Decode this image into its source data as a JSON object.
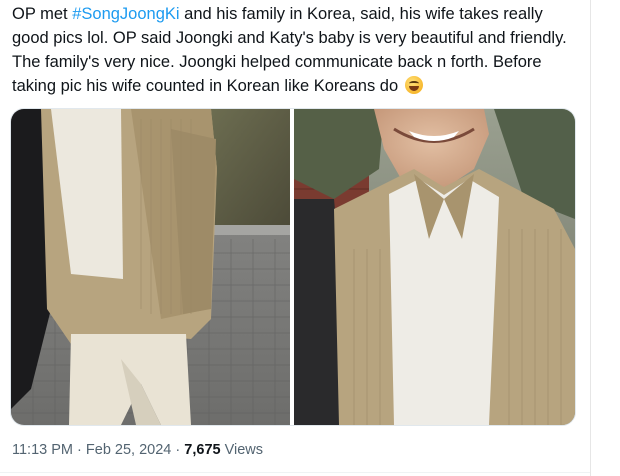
{
  "tweet": {
    "text_before": "OP met ",
    "hashtag": "#SongJoongKi",
    "text_after": " and his family in Korea, said, his wife takes really good pics lol. OP said Joongki and Katy's baby is very beautiful and friendly. The family's very nice. Joongki helped communicate back n forth. Before taking pic his wife counted in Korean like Koreans do",
    "emoji": "grinning-squinting-face-emoji"
  },
  "meta": {
    "time": "11:13 PM",
    "separator": "·",
    "date": "Feb 25, 2024",
    "views_count": "7,675",
    "views_label": "Views"
  },
  "colors": {
    "hashtag": "#1d9bf0",
    "meta_text": "#536471",
    "jacket": "#b7a47f",
    "pants": "#e9e3d4"
  }
}
